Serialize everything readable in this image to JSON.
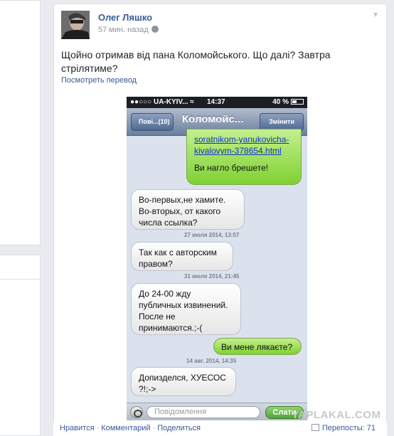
{
  "post": {
    "author": "Олег Ляшко",
    "time": "57 мин. назад",
    "text": "Щойно отримав від пана Коломойського. Що далі? Завтра стрілятиме?",
    "translate_link": "Посмотреть перевод"
  },
  "phone": {
    "carrier": "UA-KYIV...",
    "clock": "14:37",
    "battery": "40 %",
    "back_label": "Пові...(10)",
    "title": "Коломойс...",
    "edit_label": "Змінити",
    "messages": [
      {
        "link": "soratnikom-yanukovicha-kivalovym-378654.html",
        "text": "Ви нагло брешете!"
      },
      {
        "text": "Во-первых,не хамите. Во-вторых,        от какого числа ссылка?"
      },
      {
        "stamp": "27 июля 2014, 13:57"
      },
      {
        "text": "Так как с авторским правом?"
      },
      {
        "stamp": "31 июля 2014, 21:45"
      },
      {
        "text": "До 24-00 жду публичных извинений. После не принимаются.;-("
      },
      {
        "text": "Ви мене лякаєте?"
      },
      {
        "stamp": "14 авг. 2014, 14:35"
      },
      {
        "text": "Допизделся, ХУЕСОС ?!;->"
      }
    ],
    "input_placeholder": "Повідомлення",
    "send_label": "Слати"
  },
  "watermark": "YAPLAKAL.COM",
  "footer": {
    "like": "Нравится",
    "comment": "Комментарий",
    "share": "Поделиться",
    "reposts": "Перепосты: 71"
  }
}
